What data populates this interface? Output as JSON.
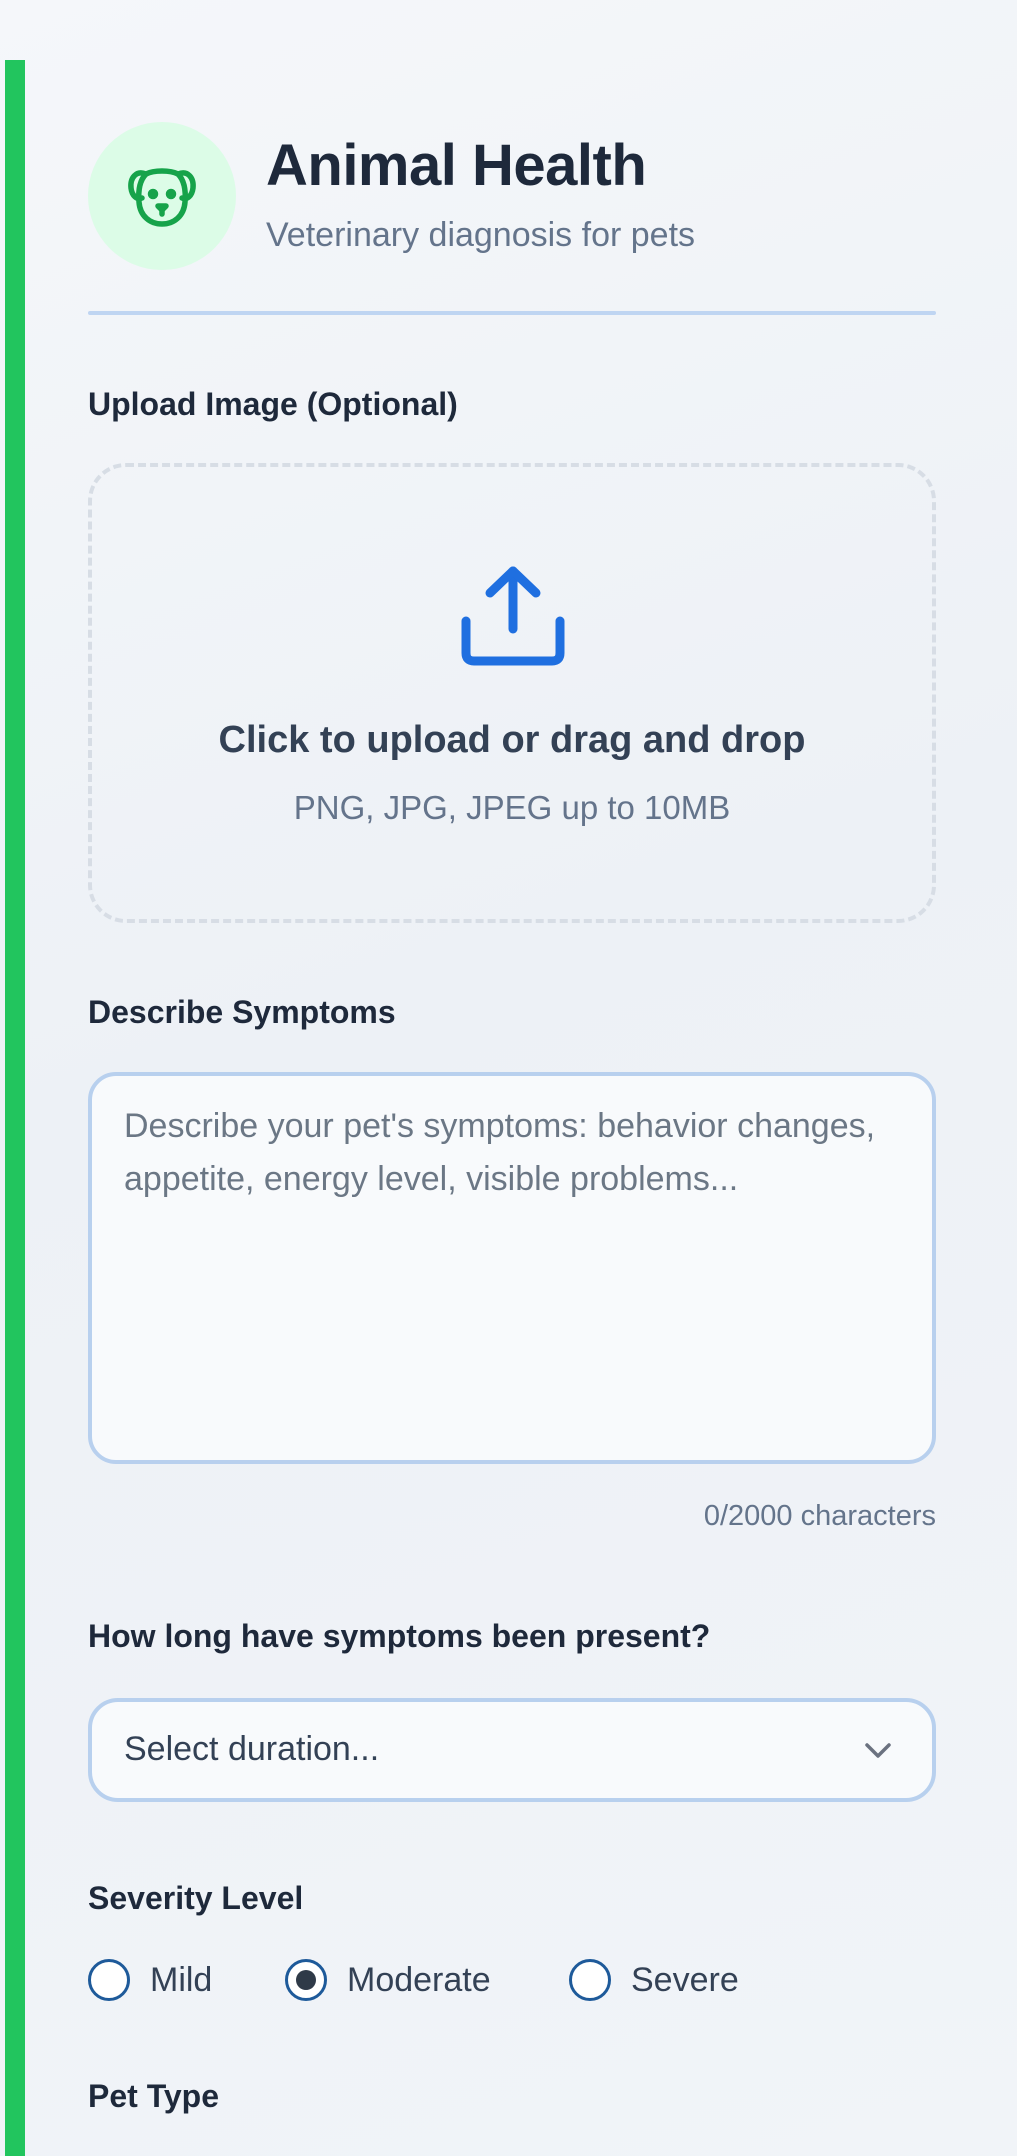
{
  "header": {
    "title": "Animal Health",
    "subtitle": "Veterinary diagnosis for pets",
    "avatar_icon": "dog-face-icon"
  },
  "upload": {
    "label": "Upload Image (Optional)",
    "main_text": "Click to upload or drag and drop",
    "sub_text": "PNG, JPG, JPEG up to 10MB",
    "icon": "upload-icon"
  },
  "symptoms": {
    "label": "Describe Symptoms",
    "placeholder": "Describe your pet's symptoms: behavior changes, appetite, energy level, visible problems...",
    "value": "",
    "char_count": "0/2000 characters"
  },
  "duration": {
    "label": "How long have symptoms been present?",
    "selected": "Select duration..."
  },
  "severity": {
    "label": "Severity Level",
    "options": [
      {
        "label": "Mild",
        "checked": false
      },
      {
        "label": "Moderate",
        "checked": true
      },
      {
        "label": "Severe",
        "checked": false
      }
    ]
  },
  "pet_type": {
    "label": "Pet Type"
  },
  "colors": {
    "accent": "#22c55e",
    "avatar_bg": "#dcfce7",
    "icon_blue": "#1f6fe0",
    "input_border": "#b8d0ee"
  }
}
